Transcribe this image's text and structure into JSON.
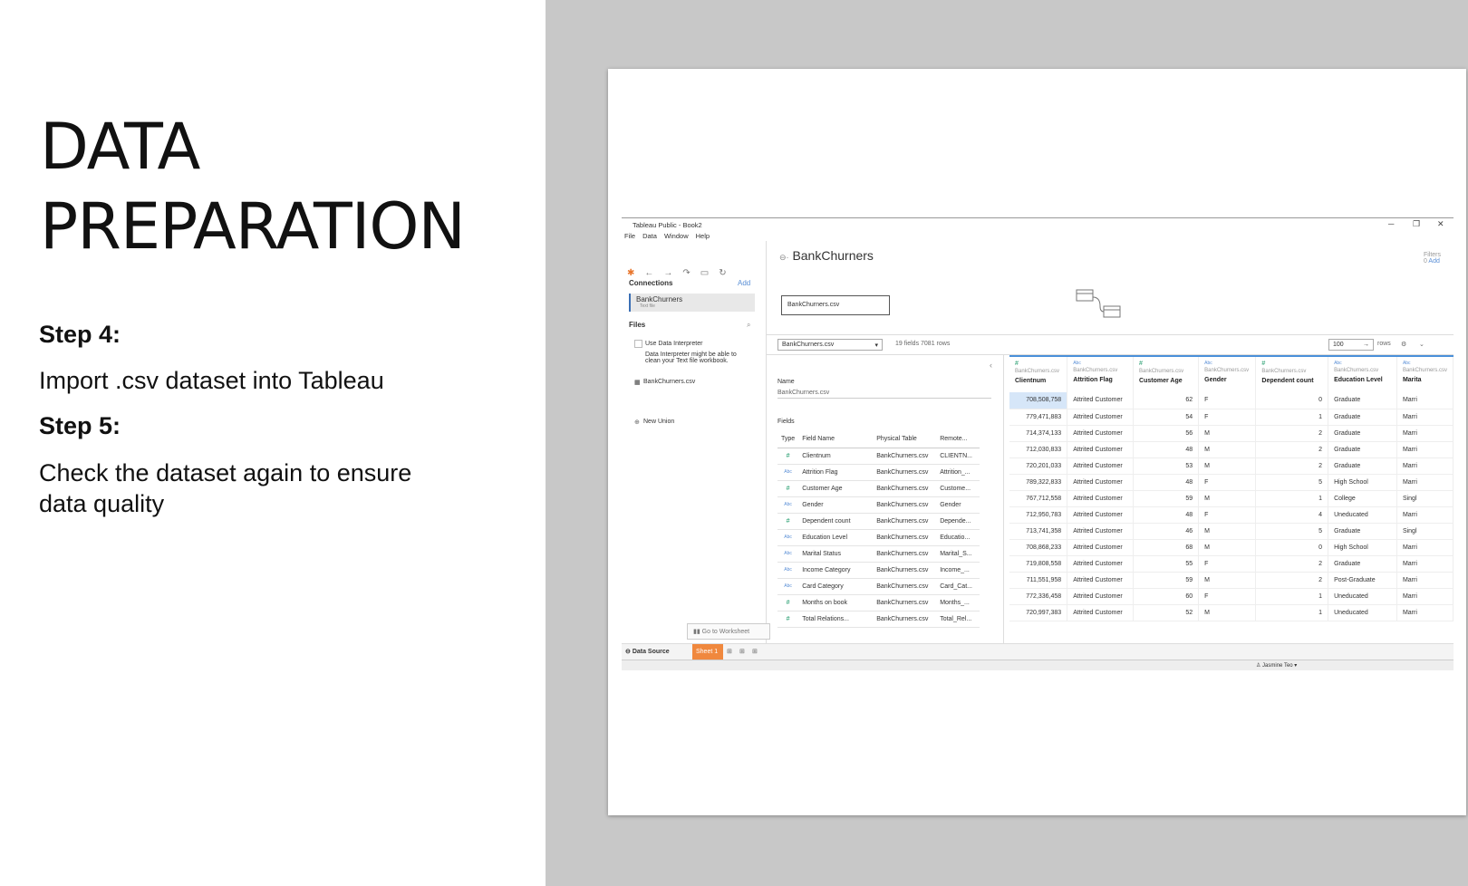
{
  "slide": {
    "title_line1": "DATA",
    "title_line2": "PREPARATION",
    "step4_label": "Step 4:",
    "step4_text": "Import .csv dataset into Tableau",
    "step5_label": "Step 5:",
    "step5_text": "Check the dataset again to ensure data quality"
  },
  "window": {
    "title": "Tableau Public - Book2",
    "menu": [
      "File",
      "Data",
      "Window",
      "Help"
    ],
    "controls": {
      "min": "─",
      "max": "❐",
      "close": "✕"
    }
  },
  "sidebar": {
    "connections_label": "Connections",
    "add_label": "Add",
    "connection_name": "BankChurners",
    "connection_type": "Text file",
    "files_label": "Files",
    "interpreter_label": "Use Data Interpreter",
    "interpreter_note": "Data Interpreter might be able to clean your Text file workbook.",
    "file_name": "BankChurners.csv",
    "new_union": "New Union"
  },
  "canvas": {
    "datasource_title": "BankChurners",
    "filters_label": "Filters",
    "filters_count": "0",
    "filters_add": "Add",
    "table_name": "BankChurners.csv"
  },
  "grid_toolbar": {
    "table_select": "BankChurners.csv",
    "meta": "19 fields 7081 rows",
    "rows_value": "100",
    "rows_label": "rows"
  },
  "metadata": {
    "name_label": "Name",
    "name_value": "BankChurners.csv",
    "fields_label": "Fields",
    "columns": [
      "Type",
      "Field Name",
      "Physical Table",
      "Remote..."
    ],
    "rows": [
      [
        "#",
        "Clientnum",
        "BankChurners.csv",
        "CLIENTN..."
      ],
      [
        "Abc",
        "Attrition Flag",
        "BankChurners.csv",
        "Attrition_..."
      ],
      [
        "#",
        "Customer Age",
        "BankChurners.csv",
        "Custome..."
      ],
      [
        "Abc",
        "Gender",
        "BankChurners.csv",
        "Gender"
      ],
      [
        "#",
        "Dependent count",
        "BankChurners.csv",
        "Depende..."
      ],
      [
        "Abc",
        "Education Level",
        "BankChurners.csv",
        "Educatio..."
      ],
      [
        "Abc",
        "Marital Status",
        "BankChurners.csv",
        "Marital_S..."
      ],
      [
        "Abc",
        "Income Category",
        "BankChurners.csv",
        "Income_..."
      ],
      [
        "Abc",
        "Card Category",
        "BankChurners.csv",
        "Card_Cat..."
      ],
      [
        "#",
        "Months on book",
        "BankChurners.csv",
        "Months_..."
      ],
      [
        "#",
        "Total Relations...",
        "BankChurners.csv",
        "Total_Rel..."
      ]
    ]
  },
  "data_grid": {
    "source": "BankChurners.csv",
    "columns": [
      {
        "type": "#",
        "name": "Clientnum"
      },
      {
        "type": "Abc",
        "name": "Attrition Flag"
      },
      {
        "type": "#",
        "name": "Customer Age"
      },
      {
        "type": "Abc",
        "name": "Gender"
      },
      {
        "type": "#",
        "name": "Dependent count"
      },
      {
        "type": "Abc",
        "name": "Education Level"
      },
      {
        "type": "Abc",
        "name": "Marita"
      }
    ],
    "rows": [
      [
        "708,508,758",
        "Attrited Customer",
        "62",
        "F",
        "0",
        "Graduate",
        "Marri"
      ],
      [
        "779,471,883",
        "Attrited Customer",
        "54",
        "F",
        "1",
        "Graduate",
        "Marri"
      ],
      [
        "714,374,133",
        "Attrited Customer",
        "56",
        "M",
        "2",
        "Graduate",
        "Marri"
      ],
      [
        "712,030,833",
        "Attrited Customer",
        "48",
        "M",
        "2",
        "Graduate",
        "Marri"
      ],
      [
        "720,201,033",
        "Attrited Customer",
        "53",
        "M",
        "2",
        "Graduate",
        "Marri"
      ],
      [
        "789,322,833",
        "Attrited Customer",
        "48",
        "F",
        "5",
        "High School",
        "Marri"
      ],
      [
        "767,712,558",
        "Attrited Customer",
        "59",
        "M",
        "1",
        "College",
        "Singl"
      ],
      [
        "712,950,783",
        "Attrited Customer",
        "48",
        "F",
        "4",
        "Uneducated",
        "Marri"
      ],
      [
        "713,741,358",
        "Attrited Customer",
        "46",
        "M",
        "5",
        "Graduate",
        "Singl"
      ],
      [
        "708,868,233",
        "Attrited Customer",
        "68",
        "M",
        "0",
        "High School",
        "Marri"
      ],
      [
        "719,808,558",
        "Attrited Customer",
        "55",
        "F",
        "2",
        "Graduate",
        "Marri"
      ],
      [
        "711,551,958",
        "Attrited Customer",
        "59",
        "M",
        "2",
        "Post-Graduate",
        "Marri"
      ],
      [
        "772,336,458",
        "Attrited Customer",
        "60",
        "F",
        "1",
        "Uneducated",
        "Marri"
      ],
      [
        "720,997,383",
        "Attrited Customer",
        "52",
        "M",
        "1",
        "Uneducated",
        "Marri"
      ]
    ]
  },
  "bottom": {
    "data_source_tab": "Data Source",
    "sheet_tab": "Sheet 1",
    "goto_worksheet": "Go to Worksheet",
    "user": "Jasmine Teo"
  },
  "colors": {
    "sheet_tab": "#f0883e",
    "header_accent": "#4a90d9",
    "number_type": "#1e9a6a"
  }
}
